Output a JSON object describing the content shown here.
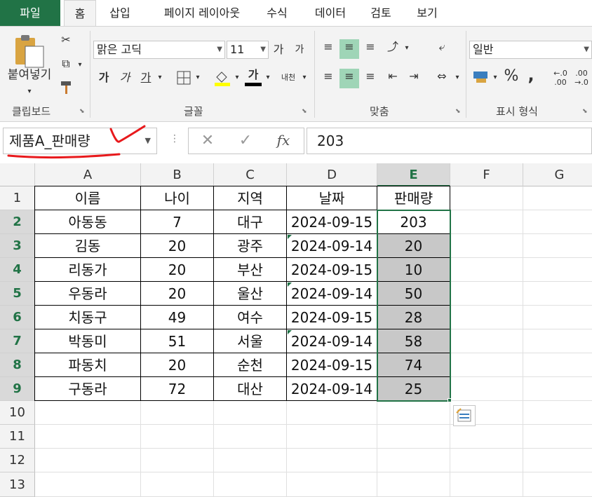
{
  "tabs": {
    "file": "파일",
    "home": "홈",
    "insert": "삽입",
    "layout": "페이지 레이아웃",
    "formulas": "수식",
    "data": "데이터",
    "review": "검토",
    "view": "보기"
  },
  "ribbon": {
    "clipboard": {
      "paste_label": "붙여넣기",
      "group_label": "클립보드"
    },
    "font": {
      "font_name": "맑은 고딕",
      "font_size": "11",
      "group_label": "글꼴",
      "grow": "가",
      "shrink": "가",
      "bold": "가",
      "italic": "가",
      "underline": "가",
      "color_letter": "가",
      "phonetic": "내천"
    },
    "alignment": {
      "group_label": "맞춤"
    },
    "number": {
      "format": "일반",
      "group_label": "표시 형식",
      "percent": "%",
      "comma": ",",
      "inc_decimal_top": "←.0",
      "inc_decimal_bottom": ".00",
      "dec_decimal_top": ".00",
      "dec_decimal_bottom": "→.0"
    }
  },
  "formula_bar": {
    "name_box": "제품A_판매량",
    "fx": "fx",
    "value": "203"
  },
  "grid": {
    "columns": [
      "A",
      "B",
      "C",
      "D",
      "E",
      "F",
      "G"
    ],
    "selected_column": "E",
    "rows": [
      "1",
      "2",
      "3",
      "4",
      "5",
      "6",
      "7",
      "8",
      "9",
      "10",
      "11",
      "12",
      "13"
    ],
    "headers": [
      "이름",
      "나이",
      "지역",
      "날짜",
      "판매량"
    ],
    "data": [
      [
        "아동동",
        "7",
        "대구",
        "2024-09-15",
        "203"
      ],
      [
        "김동",
        "20",
        "광주",
        "2024-09-14",
        "20"
      ],
      [
        "리동가",
        "20",
        "부산",
        "2024-09-15",
        "10"
      ],
      [
        "우동라",
        "20",
        "울산",
        "2024-09-14",
        "50"
      ],
      [
        "치동구",
        "49",
        "여수",
        "2024-09-15",
        "28"
      ],
      [
        "박동미",
        "51",
        "서울",
        "2024-09-14",
        "58"
      ],
      [
        "파동치",
        "20",
        "순천",
        "2024-09-15",
        "74"
      ],
      [
        "구동라",
        "72",
        "대산",
        "2024-09-14",
        "25"
      ]
    ]
  },
  "colors": {
    "accent": "#217346",
    "selection_fill": "#c8c8c8",
    "annotation": "#e8191c"
  }
}
